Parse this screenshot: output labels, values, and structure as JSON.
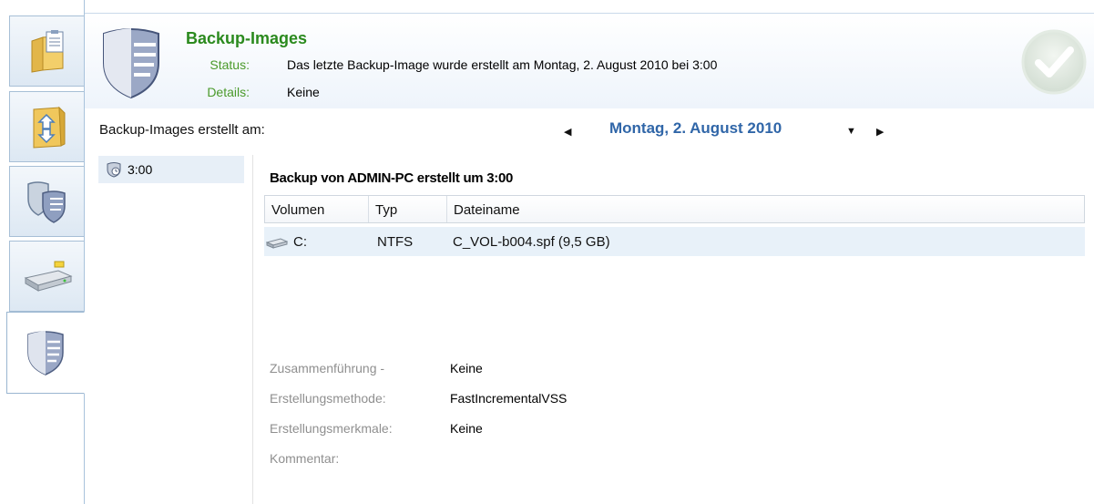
{
  "header": {
    "title": "Backup-Images",
    "status_label": "Status:",
    "status_value": "Das letzte Backup-Image wurde erstellt am Montag, 2. August 2010 bei 3:00",
    "details_label": "Details:",
    "details_value": "Keine",
    "status_icon": "checkmark-icon",
    "accent_color": "#2b8a1e"
  },
  "sidebar": {
    "items": [
      {
        "icon": "folder-clipboard-icon"
      },
      {
        "icon": "folder-restore-icon"
      },
      {
        "icon": "double-shield-icon"
      },
      {
        "icon": "hard-drive-icon"
      },
      {
        "icon": "shield-icon",
        "active": true
      }
    ]
  },
  "date_bar": {
    "label": "Backup-Images erstellt am:",
    "value": "Montag, 2. August 2010"
  },
  "time_list": [
    {
      "label": "3:00",
      "selected": true
    }
  ],
  "detail": {
    "title": "Backup von ADMIN-PC erstellt um 3:00",
    "columns": [
      "Volumen",
      "Typ",
      "Dateiname"
    ],
    "rows": [
      {
        "volume": "C:",
        "type": "NTFS",
        "filename": "C_VOL-b004.spf (9,5 GB)"
      }
    ],
    "properties": [
      {
        "label": "Zusammenführung -",
        "value": "Keine"
      },
      {
        "label": "Erstellungsmethode:",
        "value": "FastIncrementalVSS"
      },
      {
        "label": "Erstellungsmerkmale:",
        "value": "Keine"
      },
      {
        "label": "Kommentar:",
        "value": ""
      }
    ]
  }
}
